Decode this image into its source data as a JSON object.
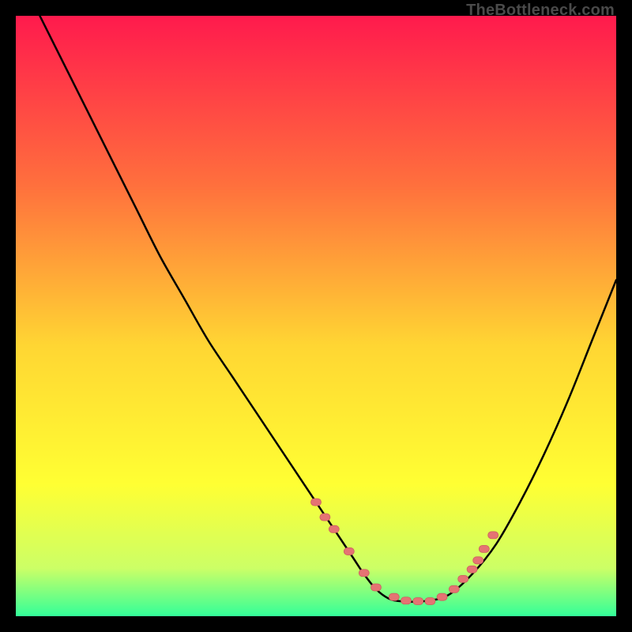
{
  "watermark": "TheBottleneck.com",
  "colors": {
    "black": "#000000",
    "curve": "#000000",
    "dot_fill": "#e57373",
    "dot_stroke": "#cc5f5f",
    "grad_top": "#ff1a4d",
    "grad_mid1": "#ff6f3d",
    "grad_mid2": "#ffd633",
    "grad_mid3": "#ffff33",
    "grad_bot1": "#ccff66",
    "grad_bot2": "#33ff99"
  },
  "chart_data": {
    "type": "line",
    "title": "",
    "xlabel": "",
    "ylabel": "",
    "xlim": [
      0,
      100
    ],
    "ylim": [
      0,
      100
    ],
    "series": [
      {
        "name": "bottleneck-curve",
        "x": [
          4,
          8,
          12,
          16,
          20,
          24,
          28,
          32,
          36,
          40,
          44,
          48,
          52,
          56,
          58,
          60,
          62,
          64,
          68,
          72,
          76,
          80,
          84,
          88,
          92,
          96,
          100
        ],
        "y": [
          100,
          92,
          84,
          76,
          68,
          60,
          53,
          46,
          40,
          34,
          28,
          22,
          16,
          10,
          7,
          4.5,
          3,
          2.5,
          2.5,
          3.5,
          7,
          12,
          19,
          27,
          36,
          46,
          56
        ]
      }
    ],
    "dots": {
      "name": "highlight-points",
      "x": [
        50,
        51.5,
        53,
        55.5,
        58,
        60,
        63,
        65,
        67,
        69,
        71,
        73,
        74.5,
        76,
        77,
        78,
        79.5
      ],
      "y": [
        19,
        16.5,
        14.5,
        10.8,
        7.2,
        4.8,
        3.2,
        2.6,
        2.5,
        2.5,
        3.2,
        4.5,
        6.2,
        7.8,
        9.3,
        11.2,
        13.5
      ]
    }
  }
}
